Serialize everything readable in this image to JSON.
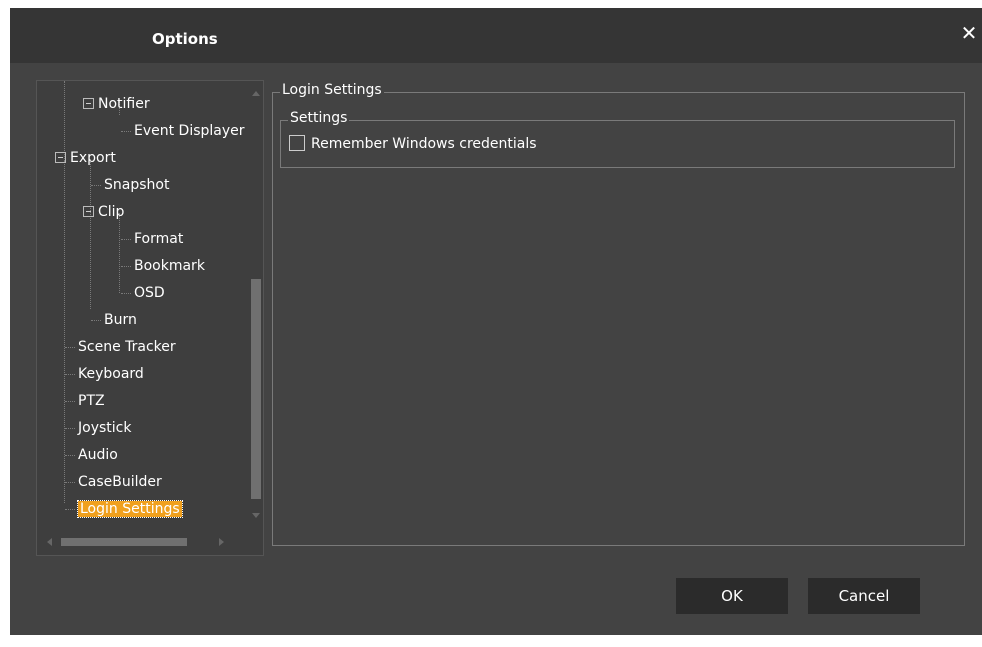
{
  "dialog": {
    "title": "Options",
    "close_glyph": "✕"
  },
  "tree": {
    "items": [
      {
        "label": "Notifier",
        "expander": "−"
      },
      {
        "label": "Event Displayer"
      },
      {
        "label": "Export",
        "expander": "−"
      },
      {
        "label": "Snapshot"
      },
      {
        "label": "Clip",
        "expander": "−"
      },
      {
        "label": "Format"
      },
      {
        "label": "Bookmark"
      },
      {
        "label": "OSD"
      },
      {
        "label": "Burn"
      },
      {
        "label": "Scene Tracker"
      },
      {
        "label": "Keyboard"
      },
      {
        "label": "PTZ"
      },
      {
        "label": "Joystick"
      },
      {
        "label": "Audio"
      },
      {
        "label": "CaseBuilder"
      },
      {
        "label": "Login Settings",
        "selected": true
      }
    ]
  },
  "panel": {
    "group_title": "Login Settings",
    "subgroup_title": "Settings",
    "checkbox_label": "Remember Windows credentials",
    "checkbox_checked": false
  },
  "buttons": {
    "ok": "OK",
    "cancel": "Cancel"
  },
  "colors": {
    "dialog_bg": "#434343",
    "titlebar_bg": "#353535",
    "selection": "#f0a01e",
    "button_bg": "#2b2b2b"
  }
}
